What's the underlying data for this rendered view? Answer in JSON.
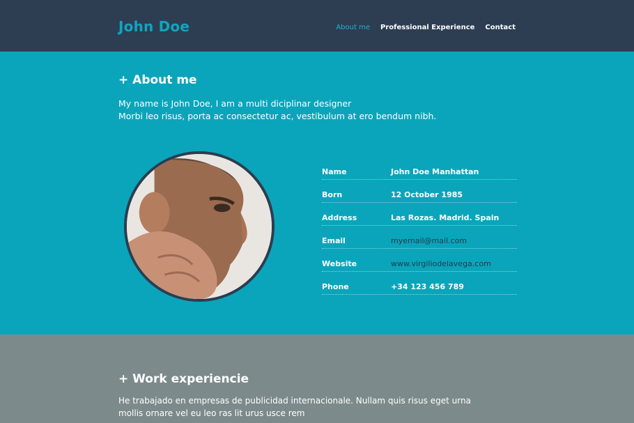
{
  "header": {
    "brand": "John Doe",
    "nav": [
      {
        "label": "About me"
      },
      {
        "label": "Professional Experience"
      },
      {
        "label": "Contact"
      }
    ]
  },
  "about": {
    "title": "+ About me",
    "intro_line1": "My name is John Doe, I am a multi diciplinar designer",
    "intro_line2": "Morbi leo risus, porta ac consectetur ac, vestibulum at ero bendum nibh.",
    "details": [
      {
        "label": "Name",
        "value": "John Doe Manhattan"
      },
      {
        "label": "Born",
        "value": "12 October 1985"
      },
      {
        "label": "Address",
        "value": "Las Rozas. Madrid. Spain"
      },
      {
        "label": "Email",
        "value": "myemail@mail.com"
      },
      {
        "label": "Website",
        "value": "www.virgiliodelavega.com"
      },
      {
        "label": "Phone",
        "value": "+34 123 456 789"
      }
    ]
  },
  "work": {
    "title": "+ Work experiencie",
    "text_line1": "He trabajado en empresas de publicidad internacionale. Nullam quis risus eget urna",
    "text_line2": "mollis ornare vel eu leo ras lit urus usce rem"
  },
  "colors": {
    "header_bg": "#2d3e52",
    "accent": "#0fa5c0",
    "about_bg": "#0aa5bb",
    "work_bg": "#7d8a8b",
    "link_dark": "#25394d"
  }
}
